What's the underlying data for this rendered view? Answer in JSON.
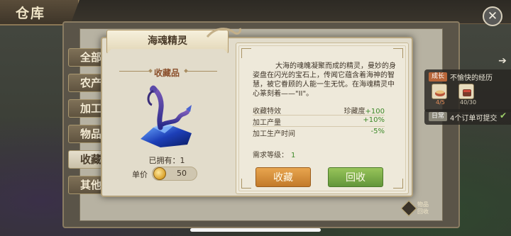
{
  "page": {
    "title": "仓库",
    "close_icon": "close-icon"
  },
  "sidebar": {
    "tabs": [
      {
        "label": "全部"
      },
      {
        "label": "农产品"
      },
      {
        "label": "加工品"
      },
      {
        "label": "物品"
      },
      {
        "label": "收藏品",
        "active": true
      },
      {
        "label": "其他"
      }
    ]
  },
  "quests": {
    "growth": {
      "badge": "成长",
      "title": "不愉快的经历",
      "items": [
        {
          "icon": "food-bowl-icon",
          "count": "4/5"
        },
        {
          "icon": "pot-icon",
          "count": "40/30"
        }
      ]
    },
    "daily": {
      "badge": "日常",
      "text": "4个订单可提交"
    }
  },
  "corner_button": {
    "label_line1": "物品",
    "label_line2": "回收"
  },
  "dialog": {
    "item_name": "海魂精灵",
    "category": "收藏品",
    "owned": "已拥有：1",
    "price_label": "单价",
    "price": "50",
    "description": "大海的魂魄凝聚而成的精灵，曼妙的身姿盘在闪光的宝石上，传闻它蕴含着海神的智慧，被它眷顾的人能一生无忧。在海魂精灵中心篆刻着——\"II\"。",
    "stats": [
      {
        "label": "收藏特效",
        "prefix": "珍藏度",
        "value": "+100"
      },
      {
        "label": "加工产量",
        "prefix": "",
        "value": "+10%"
      },
      {
        "label": "加工生产时间",
        "prefix": "",
        "value": "-5%"
      }
    ],
    "requirement_label": "需求等级：",
    "requirement_value": "1",
    "buttons": {
      "collect": "收藏",
      "recycle": "回收"
    }
  },
  "colors": {
    "positive": "#3e8a2a",
    "collect_button": "#d88f3d",
    "recycle_button": "#7cae48",
    "category_text": "#8a4e2a"
  }
}
